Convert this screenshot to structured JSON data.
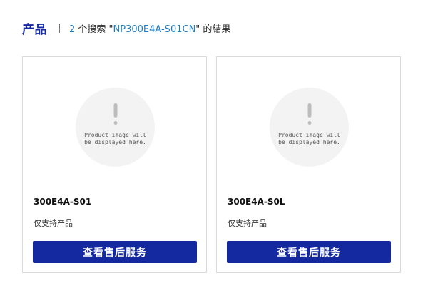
{
  "header": {
    "title": "产品",
    "result_count": "2",
    "result_prefix": " 个搜索 \"",
    "query": "NP300E4A-S01CN",
    "result_suffix": "\" 的結果"
  },
  "products": [
    {
      "placeholder_text": "Product image will be displayed here.",
      "model": "300E4A-S01",
      "support_note": "仅支持产品",
      "button_label": "查看售后服务"
    },
    {
      "placeholder_text": "Product image will be displayed here.",
      "model": "300E4A-S0L",
      "support_note": "仅支持产品",
      "button_label": "查看售后服务"
    }
  ],
  "colors": {
    "brand": "#1428a0",
    "link": "#1f7dc4"
  }
}
